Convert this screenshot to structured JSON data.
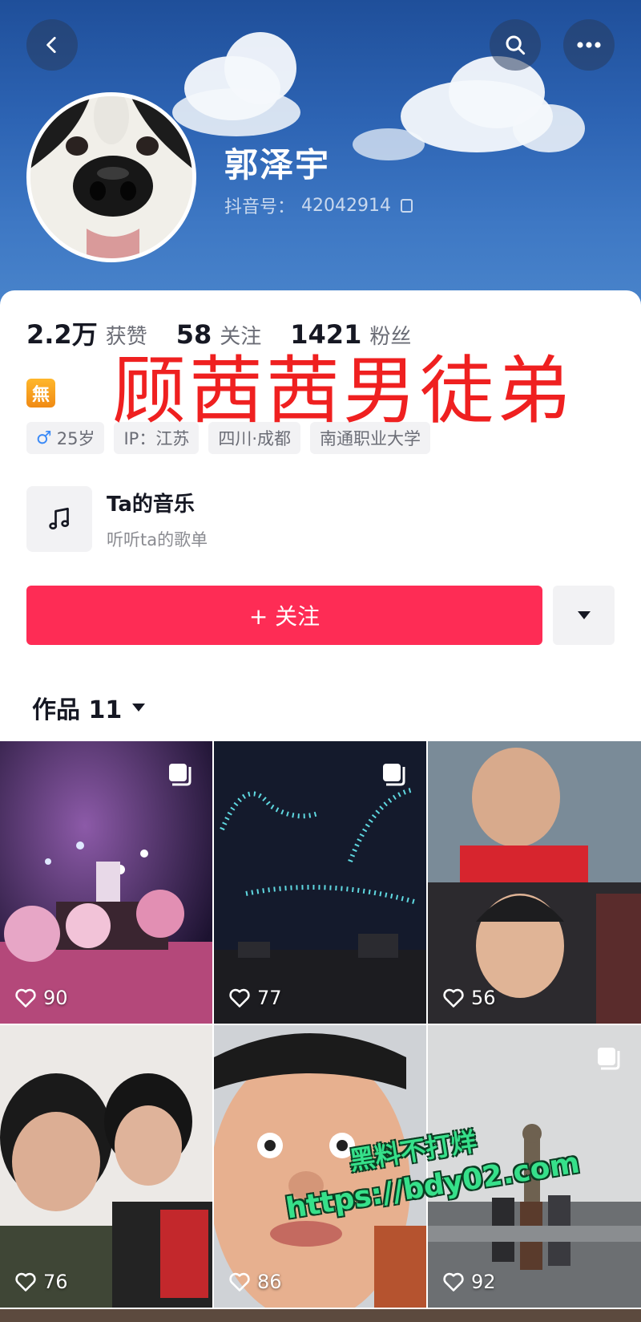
{
  "nav": {
    "back_icon": "chevron-left-icon",
    "search_icon": "search-icon",
    "more_icon": "more-horizontal-icon"
  },
  "profile": {
    "username": "郭泽宇",
    "douyin_id_label": "抖音号：",
    "douyin_id": "42042914"
  },
  "stats": [
    {
      "value": "2.2万",
      "label": "获赞"
    },
    {
      "value": "58",
      "label": "关注"
    },
    {
      "value": "1421",
      "label": "粉丝"
    }
  ],
  "badge_glyph": "無",
  "overlay_caption": "顾茜茜男徒弟",
  "tags": {
    "gender_symbol": "♂",
    "age": "25岁",
    "ip": "IP：江苏",
    "location": "四川·成都",
    "school": "南通职业大学"
  },
  "music": {
    "title": "Ta的音乐",
    "subtitle": "听听ta的歌单"
  },
  "follow_button": "+ 关注",
  "works_tab": "作品 11",
  "videos": [
    {
      "likes": "90",
      "multi": true
    },
    {
      "likes": "77",
      "multi": true
    },
    {
      "likes": "56",
      "multi": false
    },
    {
      "likes": "76",
      "multi": false
    },
    {
      "likes": "86",
      "multi": false
    },
    {
      "likes": "92",
      "multi": true
    }
  ],
  "watermark": {
    "line1": "黑料不打烊",
    "line2": "https://bdy02.com"
  },
  "colors": {
    "accent": "#fe2c55",
    "overlay_text": "#ef2020",
    "watermark": "#36e08a"
  }
}
